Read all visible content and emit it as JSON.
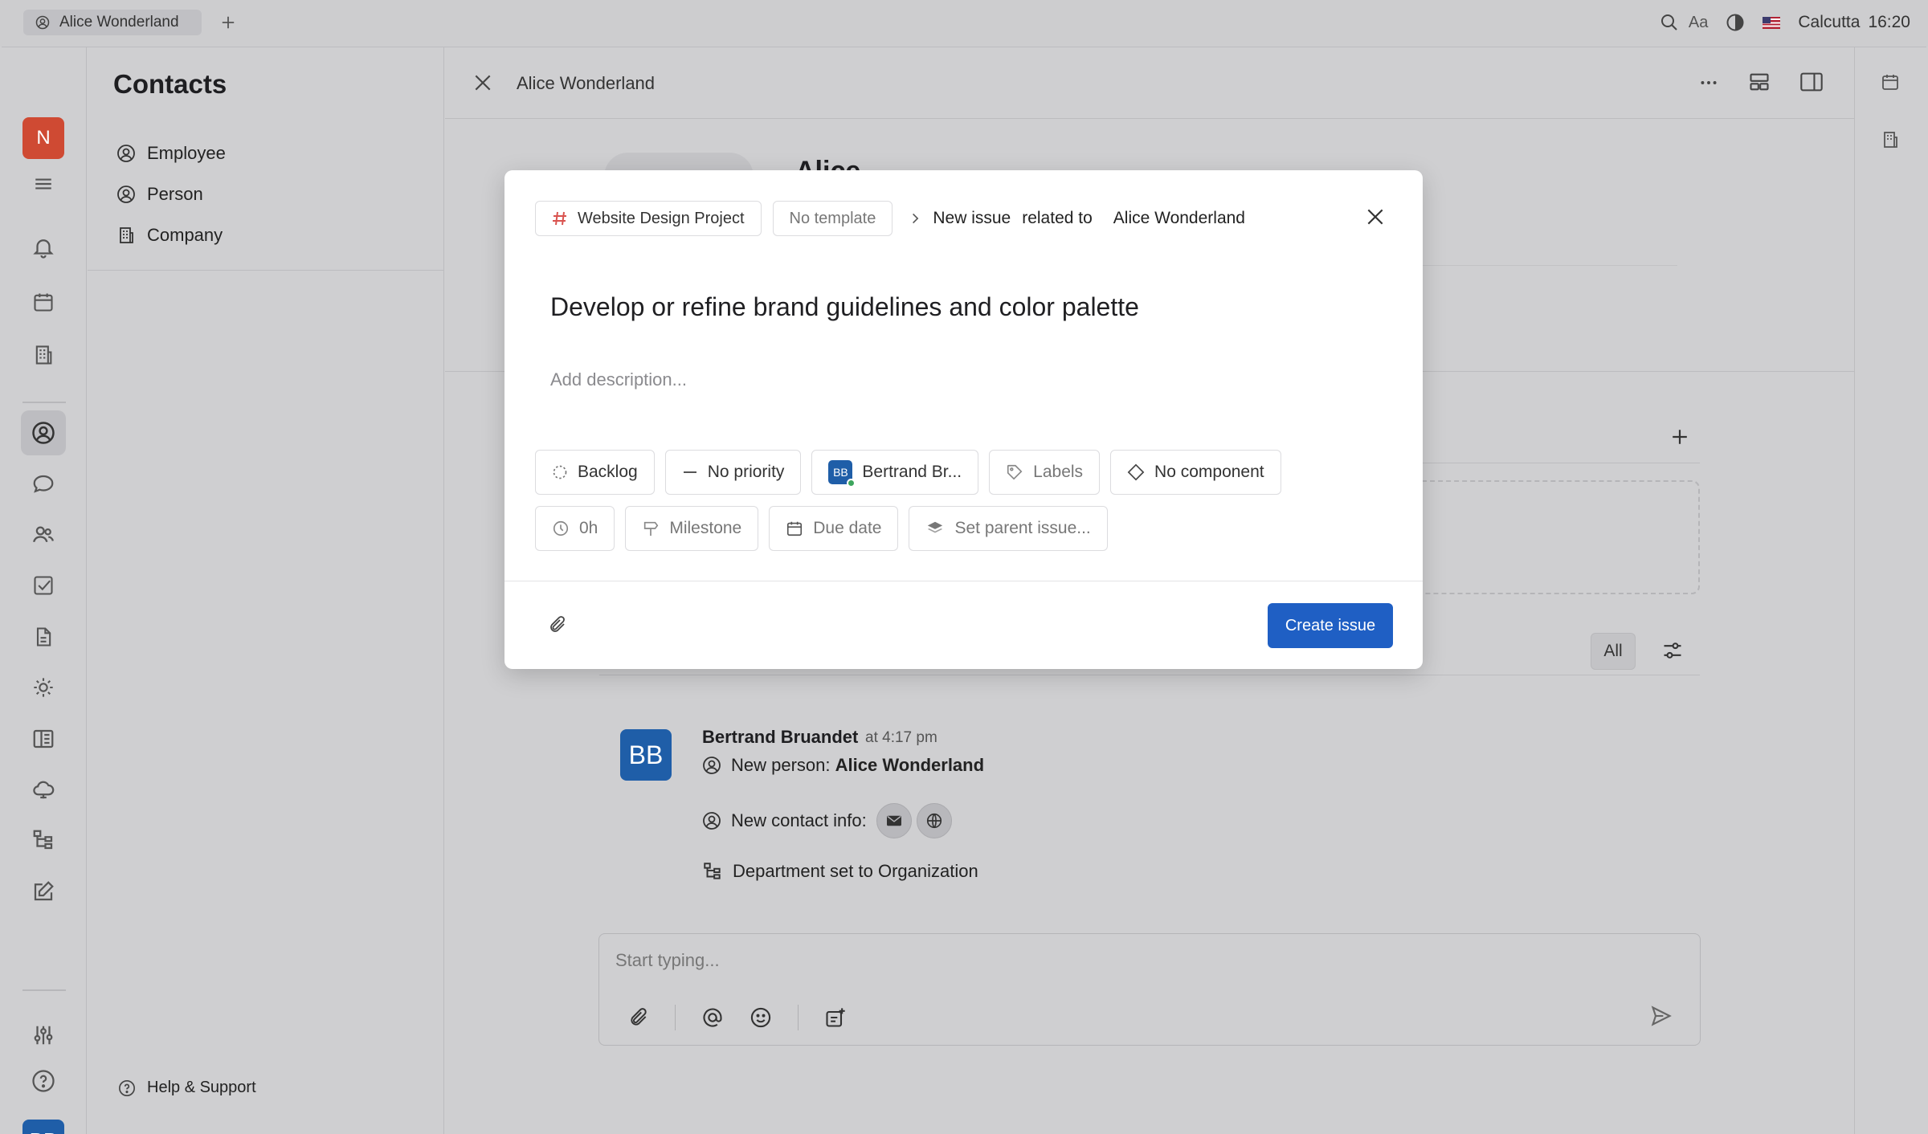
{
  "titlebar": {
    "tab_label": "Alice Wonderland",
    "font_label": "Aa",
    "location": "Calcutta",
    "time": "16:20"
  },
  "rail": {
    "workspace_initial": "N",
    "user_initials": "BB",
    "icons": [
      "menu-icon",
      "bell-icon",
      "calendar-icon",
      "office-icon",
      "contacts-icon",
      "chat-icon",
      "team-icon",
      "tasks-icon",
      "document-icon",
      "sun-icon",
      "book-icon",
      "cloud-icon",
      "tree-icon",
      "edit-icon",
      "settings-icon",
      "help-icon"
    ]
  },
  "contacts": {
    "title": "Contacts",
    "items": [
      {
        "label": "Employee",
        "icon": "person-circle-icon"
      },
      {
        "label": "Person",
        "icon": "person-circle-icon"
      },
      {
        "label": "Company",
        "icon": "building-icon"
      }
    ],
    "help_label": "Help & Support"
  },
  "document": {
    "title": "Alice Wonderland",
    "name_partial": "Alice"
  },
  "activity": {
    "filter_label": "All",
    "author_initials": "BB",
    "author": "Bertrand Bruandet",
    "time": "at 4:17 pm",
    "line1_prefix": "New person:",
    "line1_value": "Alice Wonderland",
    "line2": "New contact info:",
    "line3": "Department set to Organization"
  },
  "composer": {
    "placeholder": "Start typing..."
  },
  "modal": {
    "project": "Website Design Project",
    "template": "No template",
    "kind": "New issue",
    "related_text": "related to",
    "related_entity": "Alice Wonderland",
    "issue_title": "Develop or refine brand guidelines and color palette",
    "description_placeholder": "Add description...",
    "row1": {
      "status": "Backlog",
      "priority": "No priority",
      "assignee_initials": "BB",
      "assignee": "Bertrand Br...",
      "labels": "Labels",
      "component": "No component"
    },
    "row2": {
      "estimate": "0h",
      "milestone": "Milestone",
      "due_date": "Due date",
      "parent": "Set parent issue..."
    },
    "create_label": "Create issue"
  },
  "colors": {
    "accent": "#1f5fc4",
    "workspace_badge": "#cf4a33",
    "avatar": "#1f5ea8",
    "online": "#3da55d",
    "project_hash": "#d9534f"
  }
}
